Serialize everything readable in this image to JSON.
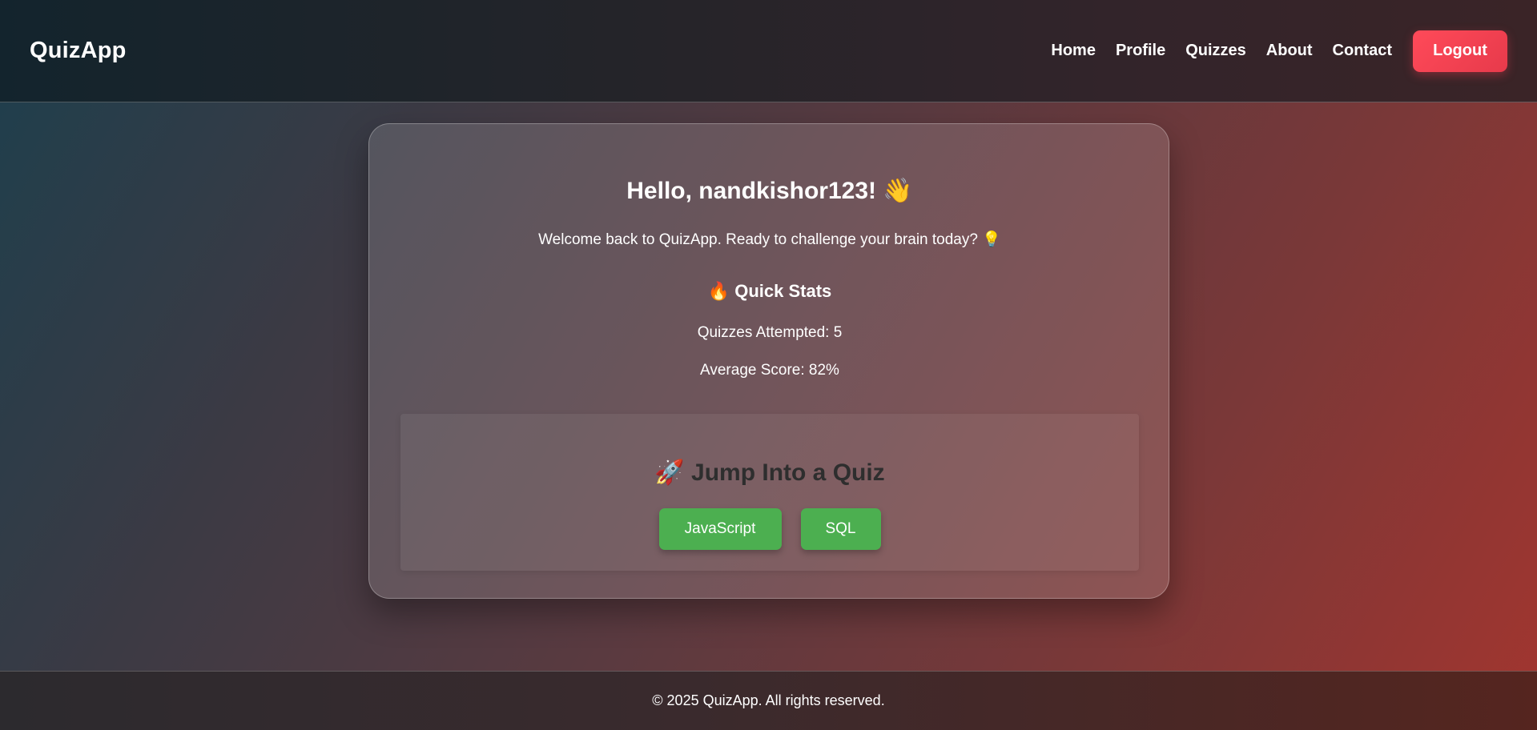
{
  "navbar": {
    "brand": "QuizApp",
    "links": [
      "Home",
      "Profile",
      "Quizzes",
      "About",
      "Contact"
    ],
    "logout_label": "Logout"
  },
  "card": {
    "greeting": "Hello, nandkishor123!",
    "greeting_emoji": "👋",
    "welcome": "Welcome back to QuizApp. Ready to challenge your brain today?",
    "welcome_emoji": "💡",
    "stats_emoji": "🔥",
    "stats_title": "Quick Stats",
    "quizzes_attempted": "Quizzes Attempted: 5",
    "average_score": "Average Score: 82%"
  },
  "quiz_panel": {
    "emoji": "🚀",
    "title": "Jump Into a Quiz",
    "buttons": [
      "JavaScript",
      "SQL"
    ]
  },
  "footer": {
    "text": "© 2025 QuizApp. All rights reserved."
  },
  "colors": {
    "logout": "#ff4a59",
    "quiz_button": "#4caf50"
  }
}
